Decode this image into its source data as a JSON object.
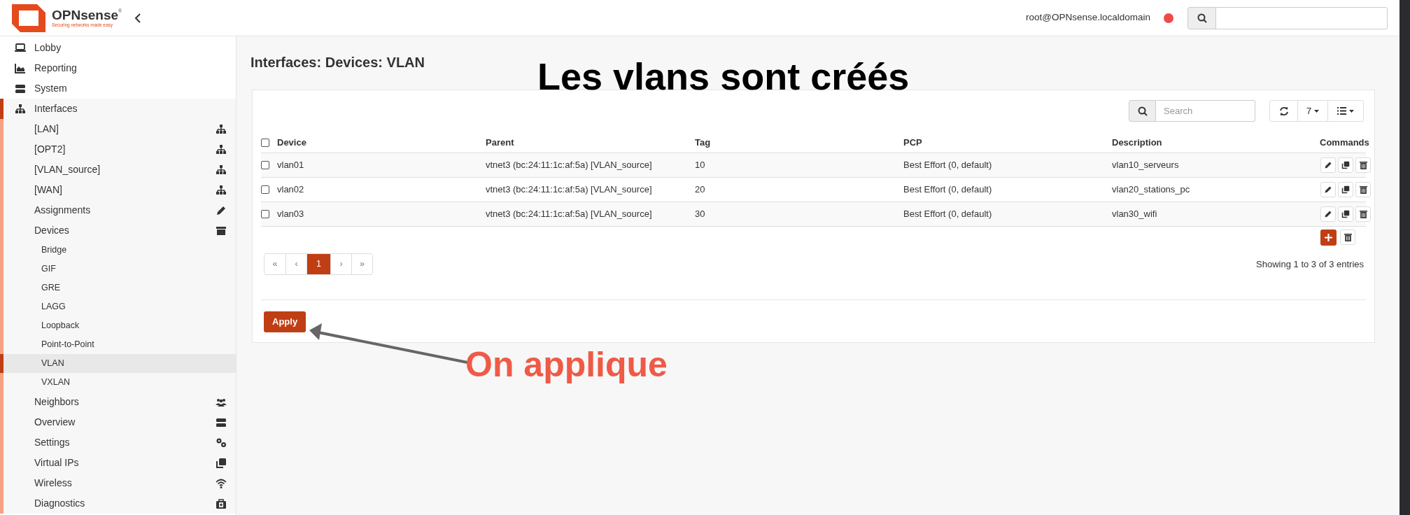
{
  "header": {
    "brand": "OPNsense",
    "trademark": "®",
    "tagline": "Securing networks made easy",
    "user": "root@OPNsense.localdomain"
  },
  "sidebar": {
    "items": [
      {
        "label": "Lobby",
        "expanded": false
      },
      {
        "label": "Reporting",
        "expanded": false
      },
      {
        "label": "System",
        "expanded": false
      },
      {
        "label": "Interfaces",
        "expanded": true,
        "children": [
          {
            "label": "[LAN]",
            "expanded": false
          },
          {
            "label": "[OPT2]",
            "expanded": false
          },
          {
            "label": "[VLAN_source]",
            "expanded": false
          },
          {
            "label": "[WAN]",
            "expanded": false
          },
          {
            "label": "Assignments",
            "expanded": false
          },
          {
            "label": "Devices",
            "expanded": true,
            "children": [
              {
                "label": "Bridge",
                "selected": false
              },
              {
                "label": "GIF",
                "selected": false
              },
              {
                "label": "GRE",
                "selected": false
              },
              {
                "label": "LAGG",
                "selected": false
              },
              {
                "label": "Loopback",
                "selected": false
              },
              {
                "label": "Point-to-Point",
                "selected": false
              },
              {
                "label": "VLAN",
                "selected": true
              },
              {
                "label": "VXLAN",
                "selected": false
              }
            ]
          },
          {
            "label": "Neighbors",
            "expanded": false
          },
          {
            "label": "Overview",
            "expanded": false
          },
          {
            "label": "Settings",
            "expanded": false
          },
          {
            "label": "Virtual IPs",
            "expanded": false
          },
          {
            "label": "Wireless",
            "expanded": false
          },
          {
            "label": "Diagnostics",
            "expanded": false
          }
        ]
      }
    ]
  },
  "page_title": "Interfaces: Devices: VLAN",
  "toolbar": {
    "search_placeholder": "Search",
    "page_size": "7"
  },
  "table": {
    "header_checked": false,
    "columns": [
      "Device",
      "Parent",
      "Tag",
      "PCP",
      "Description",
      "Commands"
    ],
    "rows": [
      {
        "selected": false,
        "cells": [
          "vlan01",
          "vtnet3 (bc:24:11:1c:af:5a) [VLAN_source]",
          "10",
          "Best Effort (0, default)",
          "vlan10_serveurs"
        ]
      },
      {
        "selected": false,
        "cells": [
          "vlan02",
          "vtnet3 (bc:24:11:1c:af:5a) [VLAN_source]",
          "20",
          "Best Effort (0, default)",
          "vlan20_stations_pc"
        ]
      },
      {
        "selected": false,
        "cells": [
          "vlan03",
          "vtnet3 (bc:24:11:1c:af:5a) [VLAN_source]",
          "30",
          "Best Effort (0, default)",
          "vlan30_wifi"
        ]
      }
    ]
  },
  "pagination": [
    {
      "label": "«",
      "selected": false
    },
    {
      "label": "‹",
      "selected": false
    },
    {
      "label": "1",
      "selected": true
    },
    {
      "label": "›",
      "selected": false
    },
    {
      "label": "»",
      "selected": false
    }
  ],
  "entries_info": "Showing 1 to 3 of 3 entries",
  "apply_button": "Apply",
  "annotations": [
    {
      "kind": "heading",
      "text": "Les vlans sont créés"
    },
    {
      "kind": "callout",
      "text": "On applique"
    }
  ]
}
